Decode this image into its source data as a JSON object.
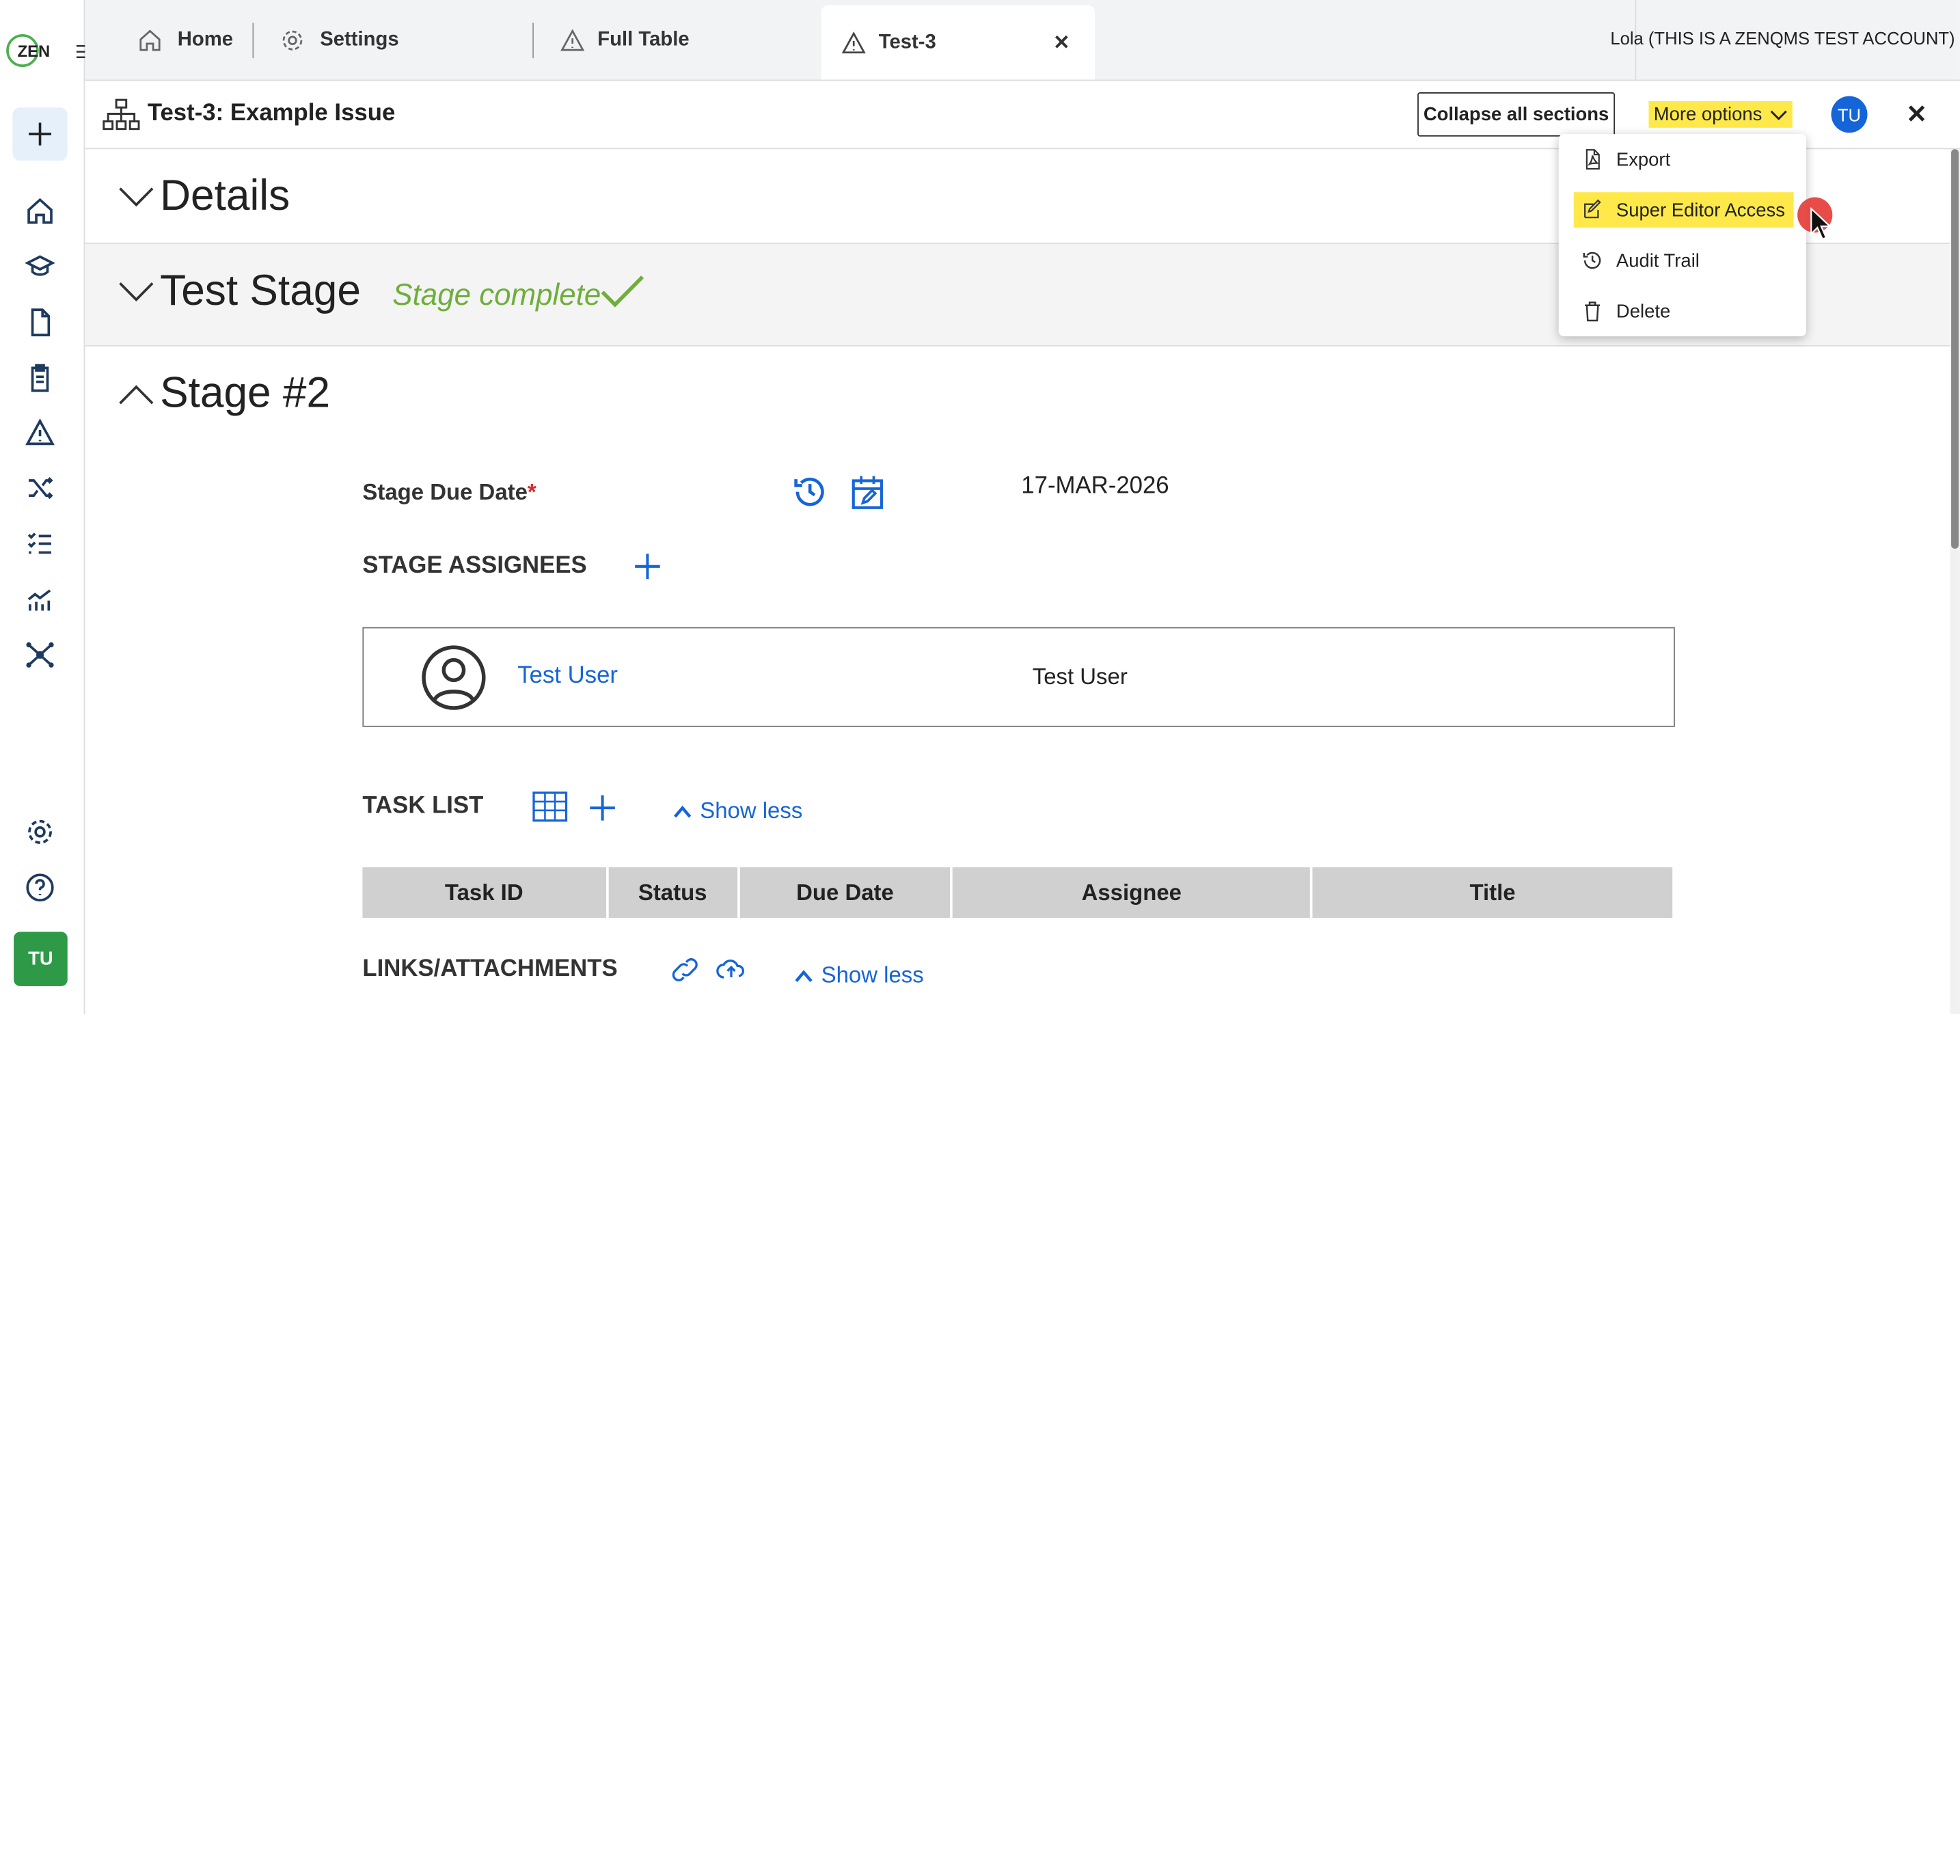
{
  "app": {
    "logo_text": "ZEN",
    "user_label": "Lola (THIS IS A ZENQMS TEST ACCOUNT)"
  },
  "tabs": [
    {
      "label": "Home",
      "icon": "home-icon"
    },
    {
      "label": "Settings",
      "icon": "gear-icon"
    },
    {
      "label": "Full Table",
      "icon": "warning-icon"
    },
    {
      "label": "Test-3",
      "icon": "warning-icon",
      "active": true
    }
  ],
  "sidebar": {
    "items": [
      "home-icon",
      "graduation-cap-icon",
      "document-icon",
      "clipboard-icon",
      "warning-icon",
      "shuffle-icon",
      "checklist-icon",
      "chart-icon",
      "network-icon"
    ],
    "bottom": [
      "gear-icon",
      "help-icon"
    ],
    "avatar": "TU"
  },
  "header": {
    "title": "Test-3: Example Issue",
    "collapse_label": "Collapse all sections",
    "more_label": "More options",
    "avatar": "TU",
    "close": "✕"
  },
  "sections": {
    "details": "Details",
    "test_stage": "Test Stage",
    "stage_complete": "Stage complete",
    "stage2": "Stage #2"
  },
  "stage2": {
    "due_label": "Stage Due Date",
    "required_mark": "*",
    "due_value": "17-MAR-2026",
    "assignees_label": "STAGE ASSIGNEES",
    "assignee_link": "Test User",
    "assignee_name": "Test User",
    "task_list_label": "TASK LIST",
    "show_less": "Show less",
    "columns": [
      "Task ID",
      "Status",
      "Due Date",
      "Assignee",
      "Title"
    ],
    "links_label": "LINKS/ATTACHMENTS",
    "links_show_less": "Show less"
  },
  "menu": {
    "items": [
      {
        "label": "Export",
        "icon": "pdf-icon"
      },
      {
        "label": "Super Editor Access",
        "icon": "edit-icon",
        "highlighted": true
      },
      {
        "label": "Audit Trail",
        "icon": "history-icon"
      },
      {
        "label": "Delete",
        "icon": "trash-icon"
      }
    ]
  },
  "colors": {
    "accent": "#1565d8",
    "highlight": "#ffe94a",
    "success": "#6fae3c",
    "avatar_green": "#2e9a48"
  }
}
